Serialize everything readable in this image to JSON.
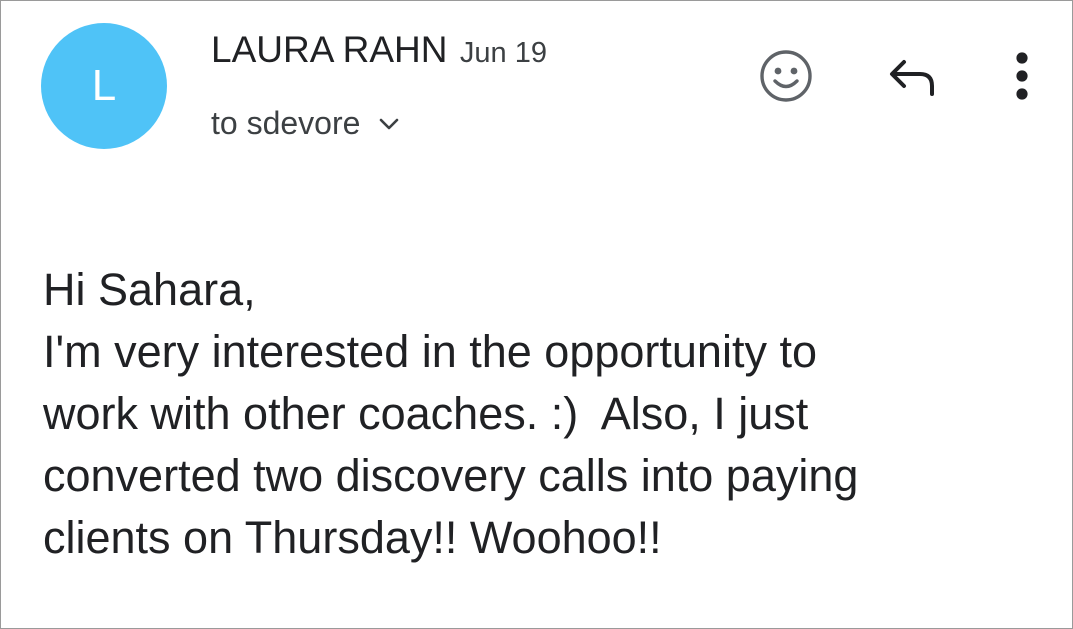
{
  "message": {
    "sender": {
      "initial": "L",
      "name": "LAURA RAHN",
      "date": "Jun 19",
      "avatar_color": "#4fc3f7"
    },
    "recipient": {
      "text": "to sdevore",
      "expand_icon": "chevron-down-icon"
    },
    "actions": {
      "emoji_icon": "emoji-smile-icon",
      "reply_icon": "reply-icon",
      "more_icon": "more-vertical-icon"
    },
    "body": {
      "lines": [
        "Hi Sahara,",
        "I'm very interested in the opportunity to",
        "work with other coaches. :)  Also, I just",
        "converted two discovery calls into paying",
        "clients on Thursday!! Woohoo!!"
      ]
    }
  }
}
